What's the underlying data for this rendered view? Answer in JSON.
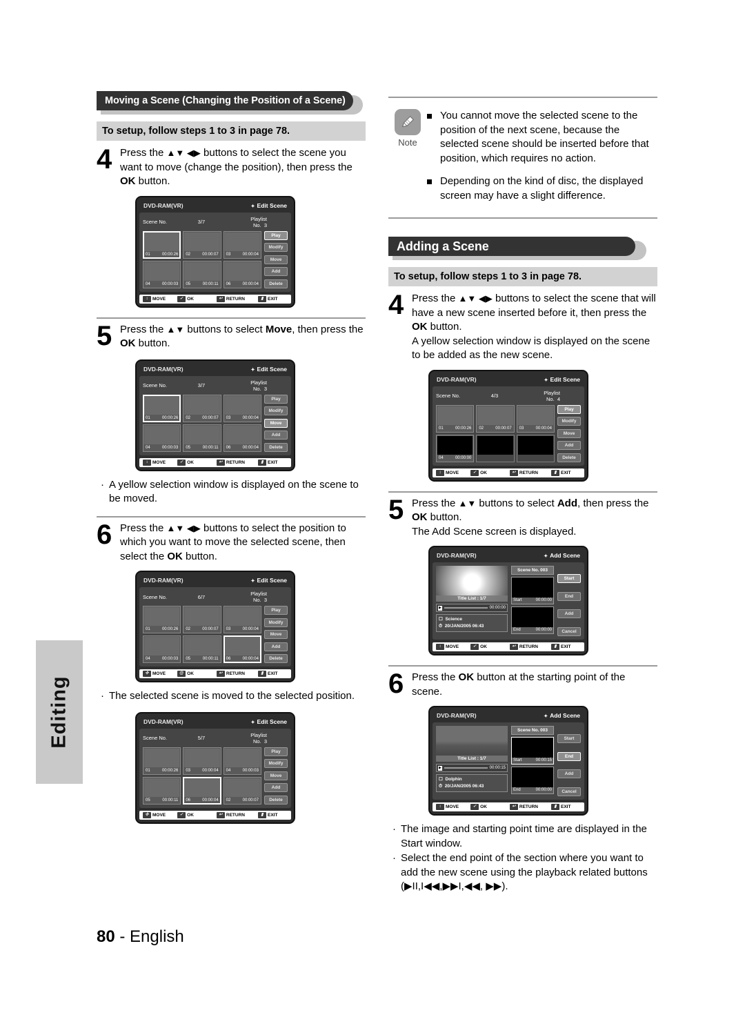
{
  "side_tab": {
    "label": "Editing"
  },
  "footer": {
    "page": "80",
    "dash": "-",
    "language": "English"
  },
  "left_column": {
    "section": {
      "title": "Moving a Scene (Changing the Position of a Scene)"
    },
    "setup_note": "To setup, follow steps 1 to 3 in page 78.",
    "steps": [
      {
        "number": "4",
        "text_parts": [
          {
            "t": "Press the "
          },
          {
            "t": "▲▼ ◀▶",
            "arrows": true
          },
          {
            "t": " buttons to select the scene you want to move (change the position), then press the "
          },
          {
            "t": "OK",
            "bold": true
          },
          {
            "t": " button."
          }
        ],
        "text": "Press the ▲▼ ◀▶ buttons to select the scene you want to move (change the position), then press the OK button."
      },
      {
        "number": "5",
        "text": "Press the ▲▼ buttons to select Move, then press the OK button."
      },
      {
        "number": "6",
        "text": "Press the ▲▼ ◀▶ buttons to select the position to which you want to move the selected scene, then select the OK button."
      }
    ],
    "bullets_after_5": [
      "A yellow selection window is displayed on the scene to be moved."
    ],
    "bullets_after_6": [
      "The selected scene is moved to the selected position."
    ]
  },
  "right_column": {
    "note": {
      "icon": "pencil-icon",
      "label": "Note",
      "items": [
        "You cannot move the selected scene to the position of the next scene, because the selected scene should be inserted before that position, which requires no action.",
        "Depending on the kind of disc, the displayed screen may have a slight difference."
      ]
    },
    "section": {
      "title": "Adding a Scene"
    },
    "setup_note": "To setup, follow steps 1 to 3 in page 78.",
    "steps": [
      {
        "number": "4",
        "text": "Press the ▲▼ ◀▶ buttons to select the scene that will have a new scene inserted before it, then press the OK button.",
        "extra": "A yellow selection window is displayed on the scene to be added as the new scene."
      },
      {
        "number": "5",
        "text": "Press the ▲▼ buttons to select Add, then press the OK button.",
        "extra": "The Add Scene screen is displayed."
      },
      {
        "number": "6",
        "text": "Press the OK button at the starting point of the scene."
      }
    ],
    "bullets_end": [
      "The image and starting point time are displayed in the Start window.",
      "Select the end point of the section where you want to add the new scene using the playback related buttons (▶II,I◀◀,▶▶I,◀◀, ▶▶)."
    ]
  },
  "screens": {
    "edit_scene_1": {
      "disc": "DVD-RAM(VR)",
      "mode": "Edit Scene",
      "scene_label": "Scene No.",
      "scene_value": "3/7",
      "playlist_label": "Playlist No.",
      "playlist_value": "3",
      "cells": [
        {
          "no": "01",
          "time": "00:00:26",
          "art": "t-leaf",
          "selected": false
        },
        {
          "no": "02",
          "time": "00:00:07",
          "art": "t-dolphin",
          "selected": false
        },
        {
          "no": "03",
          "time": "00:00:04",
          "art": "t-flower",
          "selected": true
        },
        {
          "no": "04",
          "time": "00:00:03",
          "art": "t-flower2",
          "selected": false
        },
        {
          "no": "05",
          "time": "00:00:11",
          "art": "t-bud",
          "selected": false
        },
        {
          "no": "06",
          "time": "00:00:04",
          "art": "t-field",
          "selected": false
        }
      ],
      "buttons": [
        {
          "label": "Play",
          "highlighted": true
        },
        {
          "label": "Modify",
          "highlighted": false
        },
        {
          "label": "Move",
          "highlighted": false
        },
        {
          "label": "Add",
          "highlighted": false
        },
        {
          "label": "Delete",
          "highlighted": false
        }
      ],
      "footer": [
        {
          "glyph": "↕",
          "label": "MOVE"
        },
        {
          "glyph": "✓",
          "label": "OK"
        },
        {
          "glyph": "↩",
          "label": "RETURN"
        },
        {
          "glyph": "▮",
          "label": "EXIT"
        }
      ]
    },
    "edit_scene_2": {
      "disc": "DVD-RAM(VR)",
      "mode": "Edit Scene",
      "scene_label": "Scene No.",
      "scene_value": "3/7",
      "playlist_label": "Playlist No.",
      "playlist_value": "3",
      "cells": [
        {
          "no": "01",
          "time": "00:00:26",
          "art": "t-leaf",
          "selected": true
        },
        {
          "no": "02",
          "time": "00:00:07",
          "art": "t-dolphin",
          "selected": false
        },
        {
          "no": "03",
          "time": "00:00:04",
          "art": "t-flower",
          "selected": false
        },
        {
          "no": "04",
          "time": "00:00:03",
          "art": "t-flower2",
          "selected": false
        },
        {
          "no": "05",
          "time": "00:00:11",
          "art": "t-bud",
          "selected": false
        },
        {
          "no": "06",
          "time": "00:00:04",
          "art": "t-field",
          "selected": false
        }
      ],
      "buttons": [
        {
          "label": "Play",
          "highlighted": false
        },
        {
          "label": "Modify",
          "highlighted": false
        },
        {
          "label": "Move",
          "highlighted": true
        },
        {
          "label": "Add",
          "highlighted": false
        },
        {
          "label": "Delete",
          "highlighted": false
        }
      ],
      "footer": [
        {
          "glyph": "↕",
          "label": "MOVE"
        },
        {
          "glyph": "✓",
          "label": "OK"
        },
        {
          "glyph": "↩",
          "label": "RETURN"
        },
        {
          "glyph": "▮",
          "label": "EXIT"
        }
      ]
    },
    "edit_scene_3": {
      "disc": "DVD-RAM(VR)",
      "mode": "Edit Scene",
      "scene_label": "Scene No.",
      "scene_value": "6/7",
      "playlist_label": "Playlist No.",
      "playlist_value": "3",
      "cells": [
        {
          "no": "01",
          "time": "00:00:26",
          "art": "t-leaf",
          "selected": false
        },
        {
          "no": "02",
          "time": "00:00:07",
          "art": "t-dolphin",
          "selected": false
        },
        {
          "no": "03",
          "time": "00:00:04",
          "art": "t-flower",
          "selected": false
        },
        {
          "no": "04",
          "time": "00:00:03",
          "art": "t-flower2",
          "selected": false
        },
        {
          "no": "05",
          "time": "00:00:11",
          "art": "t-bud",
          "selected": false
        },
        {
          "no": "06",
          "time": "00:00:04",
          "art": "t-field",
          "selected": true
        }
      ],
      "buttons": [
        {
          "label": "Play",
          "highlighted": false
        },
        {
          "label": "Modify",
          "highlighted": false
        },
        {
          "label": "Move",
          "highlighted": false
        },
        {
          "label": "Add",
          "highlighted": false
        },
        {
          "label": "Delete",
          "highlighted": false
        }
      ],
      "footer": [
        {
          "glyph": "✣",
          "label": "MOVE"
        },
        {
          "glyph": "@",
          "label": "OK"
        },
        {
          "glyph": "↩",
          "label": "RETURN"
        },
        {
          "glyph": "▮",
          "label": "EXIT"
        }
      ]
    },
    "edit_scene_4": {
      "disc": "DVD-RAM(VR)",
      "mode": "Edit Scene",
      "scene_label": "Scene No.",
      "scene_value": "5/7",
      "playlist_label": "Playlist No.",
      "playlist_value": "3",
      "cells": [
        {
          "no": "01",
          "time": "00:00:26",
          "art": "t-leaf",
          "selected": false
        },
        {
          "no": "03",
          "time": "00:00:04",
          "art": "t-dolphin",
          "selected": false
        },
        {
          "no": "04",
          "time": "00:00:03",
          "art": "t-flower",
          "selected": false
        },
        {
          "no": "05",
          "time": "00:00:11",
          "art": "t-bud",
          "selected": false
        },
        {
          "no": "06",
          "time": "00:00:04",
          "art": "t-flower2",
          "selected": true
        },
        {
          "no": "02",
          "time": "00:00:07",
          "art": "t-field",
          "selected": false
        }
      ],
      "buttons": [
        {
          "label": "Play",
          "highlighted": false
        },
        {
          "label": "Modify",
          "highlighted": false
        },
        {
          "label": "Move",
          "highlighted": false
        },
        {
          "label": "Add",
          "highlighted": false
        },
        {
          "label": "Delete",
          "highlighted": false
        }
      ],
      "footer": [
        {
          "glyph": "✣",
          "label": "MOVE"
        },
        {
          "glyph": "✓",
          "label": "OK"
        },
        {
          "glyph": "↩",
          "label": "RETURN"
        },
        {
          "glyph": "▮",
          "label": "EXIT"
        }
      ]
    },
    "edit_scene_5": {
      "disc": "DVD-RAM(VR)",
      "mode": "Edit Scene",
      "scene_label": "Scene No.",
      "scene_value": "4/3",
      "playlist_label": "Playlist No.",
      "playlist_value": "4",
      "cells": [
        {
          "no": "01",
          "time": "00:00:26",
          "art": "t-leaf",
          "selected": false
        },
        {
          "no": "02",
          "time": "00:00:07",
          "art": "t-dolphin",
          "selected": false
        },
        {
          "no": "03",
          "time": "00:00:04",
          "art": "t-flower",
          "selected": false
        },
        {
          "no": "04",
          "time": "00:00:00",
          "art": "empty",
          "selected": false
        },
        {
          "no": "",
          "time": "",
          "art": "blank",
          "selected": false
        },
        {
          "no": "",
          "time": "",
          "art": "blank",
          "selected": false
        }
      ],
      "buttons": [
        {
          "label": "Play",
          "highlighted": true
        },
        {
          "label": "Modify",
          "highlighted": false
        },
        {
          "label": "Move",
          "highlighted": false
        },
        {
          "label": "Add",
          "highlighted": false
        },
        {
          "label": "Delete",
          "highlighted": false
        }
      ],
      "footer": [
        {
          "glyph": "↕",
          "label": "MOVE"
        },
        {
          "glyph": "✓",
          "label": "OK"
        },
        {
          "glyph": "↩",
          "label": "RETURN"
        },
        {
          "glyph": "▮",
          "label": "EXIT"
        }
      ]
    },
    "add_scene_1": {
      "disc": "DVD-RAM(VR)",
      "mode": "Add Scene",
      "preview_label": "Title List : 1/7",
      "preview_art": "t-lily",
      "seek_time": "00:00:00",
      "info_title": "Science",
      "info_date": "20/JAN/2005 06:43",
      "scene_no": "Scene No. 003",
      "start_label": "Start",
      "start_time": "00:00:00",
      "end_label": "End",
      "end_time": "00:00:00",
      "start_filled": false,
      "buttons": [
        {
          "label": "Start",
          "highlighted": true
        },
        {
          "label": "End",
          "highlighted": false
        },
        {
          "label": "Add",
          "highlighted": false
        },
        {
          "label": "Cancel",
          "highlighted": false
        }
      ],
      "footer": [
        {
          "glyph": "↕",
          "label": "MOVE"
        },
        {
          "glyph": "✓",
          "label": "OK"
        },
        {
          "glyph": "↩",
          "label": "RETURN"
        },
        {
          "glyph": "▮",
          "label": "EXIT"
        }
      ]
    },
    "add_scene_2": {
      "disc": "DVD-RAM(VR)",
      "mode": "Add Scene",
      "preview_label": "Title List : 1/7",
      "preview_art": "t-otter",
      "seek_time": "00:00:15",
      "info_title": "Dolphin",
      "info_date": "20/JAN/2005 06:43",
      "scene_no": "Scene No. 003",
      "start_label": "Start",
      "start_time": "00:00:15",
      "end_label": "End",
      "end_time": "00:00:00",
      "start_filled": true,
      "buttons": [
        {
          "label": "Start",
          "highlighted": false
        },
        {
          "label": "End",
          "highlighted": true
        },
        {
          "label": "Add",
          "highlighted": false
        },
        {
          "label": "Cancel",
          "highlighted": false
        }
      ],
      "footer": [
        {
          "glyph": "↕",
          "label": "MOVE"
        },
        {
          "glyph": "✓",
          "label": "OK"
        },
        {
          "glyph": "↩",
          "label": "RETURN"
        },
        {
          "glyph": "▮",
          "label": "EXIT"
        }
      ]
    }
  }
}
